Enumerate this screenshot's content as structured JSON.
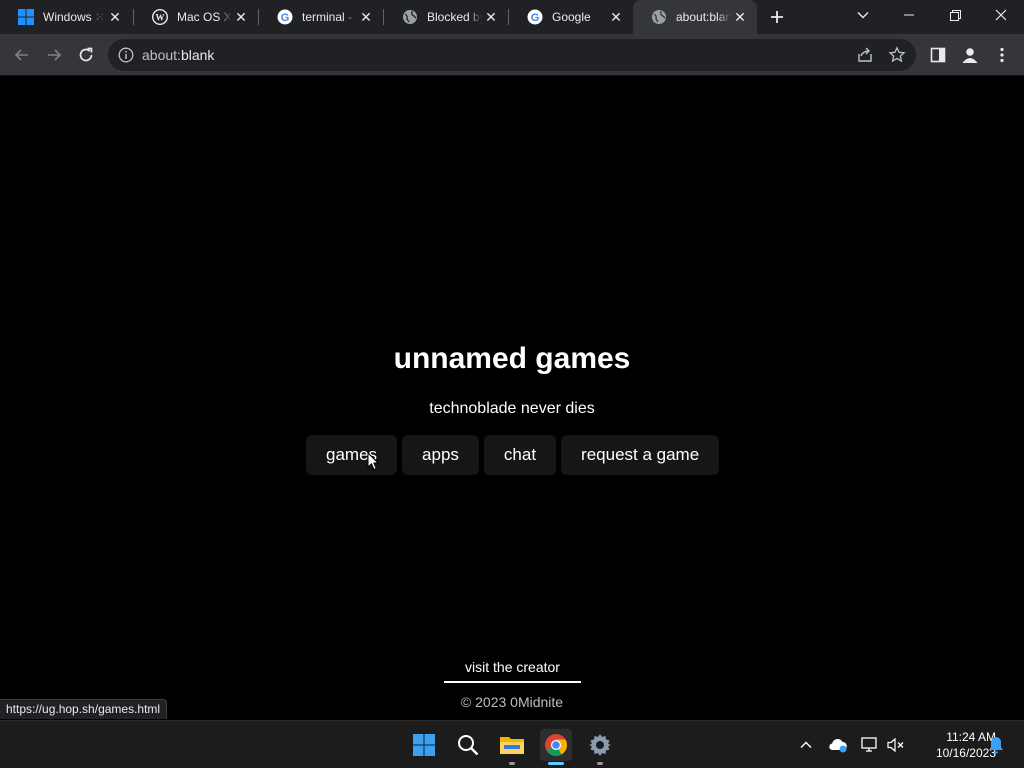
{
  "browser": {
    "tabs": [
      {
        "title": "Windows ⁙",
        "icon": "windows-logo-icon",
        "active": false
      },
      {
        "title": "Mac OS X In",
        "icon": "wordpress-icon",
        "active": false
      },
      {
        "title": "terminal - G",
        "icon": "google-icon",
        "active": false
      },
      {
        "title": "Blocked by",
        "icon": "globe-icon",
        "active": false
      },
      {
        "title": "Google",
        "icon": "google-icon",
        "active": false
      },
      {
        "title": "about:blank",
        "icon": "globe-icon",
        "active": true
      }
    ],
    "address": {
      "scheme": "about:",
      "path": "blank"
    },
    "status_url": "https://ug.hop.sh/games.html"
  },
  "page": {
    "title": "unnamed games",
    "subtitle": "technoblade never dies",
    "nav": [
      "games",
      "apps",
      "chat",
      "request a game"
    ],
    "creator_link": "visit the creator",
    "copyright": "© 2023 0Midnite"
  },
  "taskbar": {
    "apps": [
      "start-icon",
      "search-icon",
      "file-explorer-icon",
      "chrome-icon",
      "settings-icon"
    ],
    "time": "11:24 AM",
    "date": "10/16/2023"
  },
  "colors": {
    "accent": "#60cdff",
    "page_bg": "#000000",
    "button_bg": "#161616"
  }
}
